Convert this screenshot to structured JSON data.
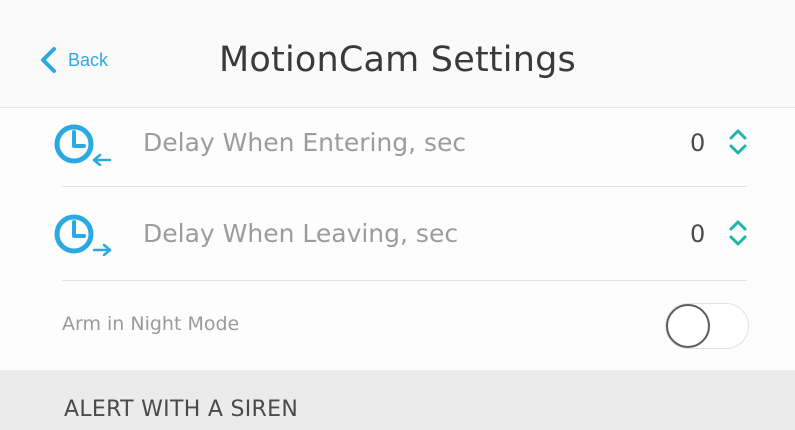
{
  "header": {
    "back_label": "Back",
    "title": "MotionCam Settings"
  },
  "settings": {
    "delay_entering": {
      "label": "Delay When Entering, sec",
      "value": "0",
      "icon": "clock-arrow-in-icon"
    },
    "delay_leaving": {
      "label": "Delay When Leaving, sec",
      "value": "0",
      "icon": "clock-arrow-out-icon"
    },
    "night_mode": {
      "label": "Arm in Night Mode",
      "enabled": false
    }
  },
  "section": {
    "title": "ALERT WITH A SIREN"
  },
  "colors": {
    "accent": "#2aa9e3",
    "teal": "#1fb5a8",
    "label_gray": "#9c9c9c"
  }
}
